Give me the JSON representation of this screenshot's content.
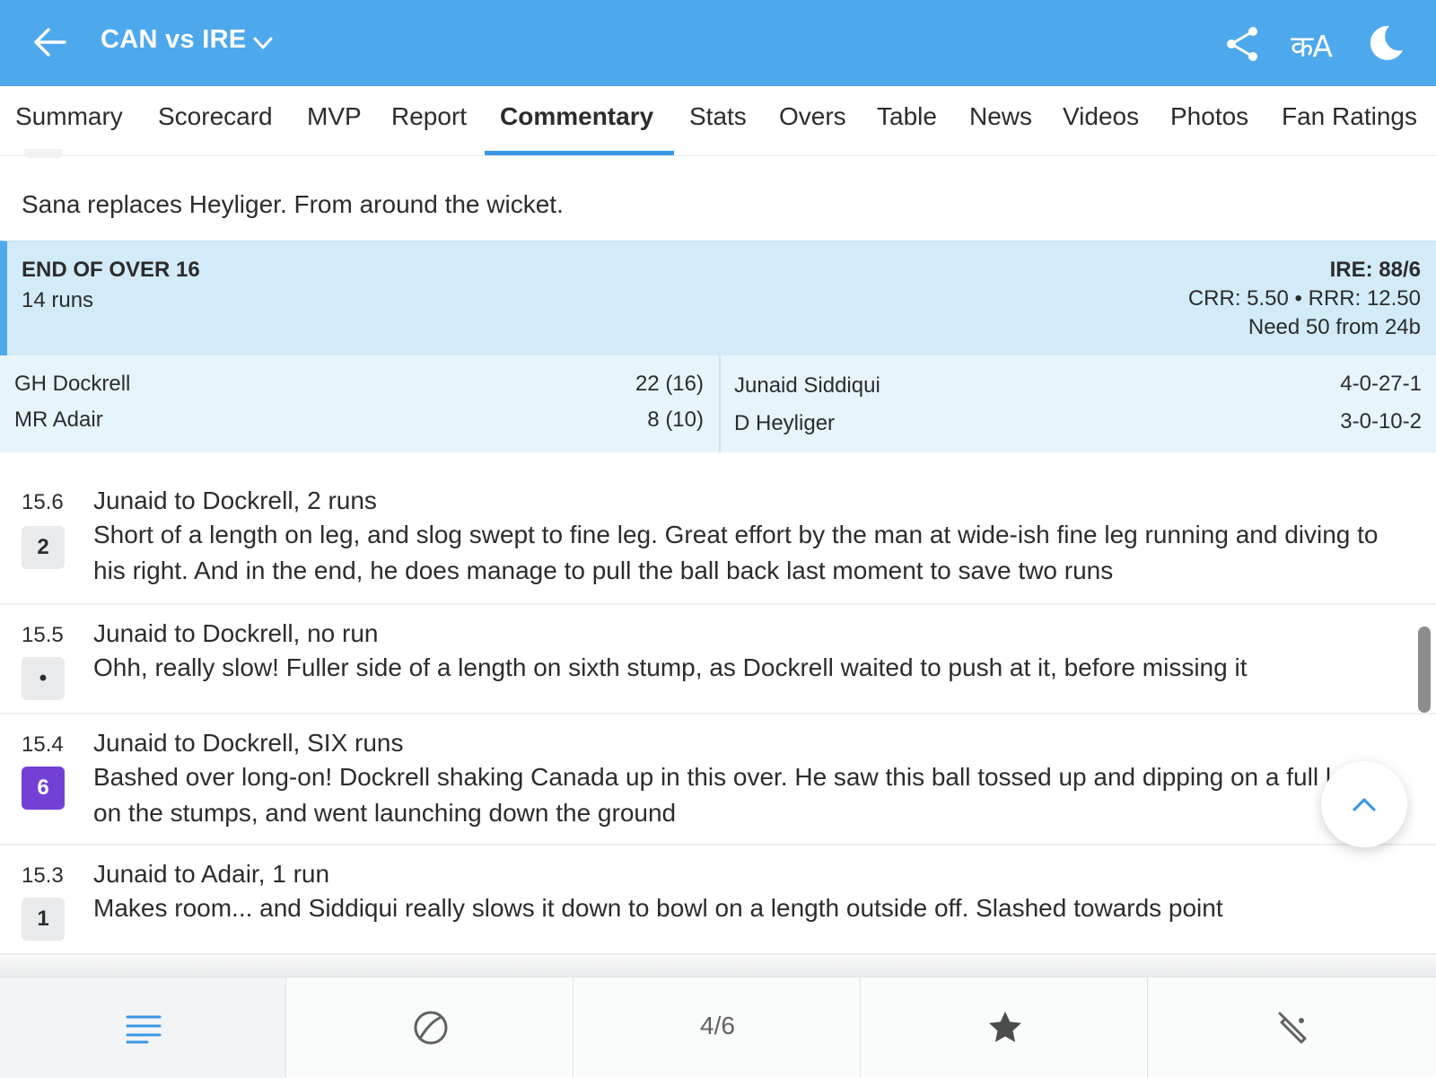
{
  "appbar": {
    "title": "CAN vs IRE",
    "lang_label": "कA",
    "icons": {
      "back": "arrow-left-icon",
      "title_dropdown": "chevron-down-icon",
      "share": "share-icon",
      "theme": "moon-icon"
    },
    "background": "#4ea8ec"
  },
  "tabs": [
    {
      "label": "Summary"
    },
    {
      "label": "Scorecard"
    },
    {
      "label": "MVP"
    },
    {
      "label": "Report"
    },
    {
      "label": "Commentary",
      "active": true
    },
    {
      "label": "Stats"
    },
    {
      "label": "Overs"
    },
    {
      "label": "Table"
    },
    {
      "label": "News"
    },
    {
      "label": "Videos"
    },
    {
      "label": "Photos"
    },
    {
      "label": "Fan Ratings"
    }
  ],
  "commentary": {
    "bowler_change": "Sana replaces Heyliger. From around the wicket.",
    "end_of_over": {
      "title": "END OF OVER 16",
      "runs": "14 runs",
      "score": "IRE: 88/6",
      "rates": "CRR: 5.50 • RRR: 12.50",
      "need": "Need 50 from 24b",
      "batters": [
        {
          "name": "GH Dockrell",
          "figures": "22 (16)"
        },
        {
          "name": "MR Adair",
          "figures": "8 (10)"
        }
      ],
      "bowlers": [
        {
          "name": "Junaid Siddiqui",
          "figures": "4-0-27-1"
        },
        {
          "name": "D Heyliger",
          "figures": "3-0-10-2"
        }
      ]
    },
    "balls": [
      {
        "over": "15.6",
        "badge": "2",
        "title": "Junaid to Dockrell, 2 runs",
        "text": "Short of a length on leg, and slog swept to fine leg. Great effort by the man at wide-ish fine leg running and diving to his right. And in the end, he does manage to pull the ball back last moment to save two runs"
      },
      {
        "over": "15.5",
        "badge": "•",
        "title": "Junaid to Dockrell, no run",
        "text": "Ohh, really slow! Fuller side of a length on sixth stump, as Dockrell waited to push at it, before missing it"
      },
      {
        "over": "15.4",
        "badge": "6",
        "badge_color": "#7340d6",
        "title": "Junaid to Dockrell, SIX runs",
        "text": "Bashed over long-on! Dockrell shaking Canada up in this over. He saw this ball tossed up and dipping on a full length on the stumps, and went launching down the ground"
      },
      {
        "over": "15.3",
        "badge": "1",
        "title": "Junaid to Adair, 1 run",
        "text": "Makes room... and Siddiqui really slows it down to bowl on a length outside off. Slashed towards point"
      }
    ]
  },
  "bottom_nav": {
    "page_indicator": "4/6",
    "icons": [
      "menu-lines-icon",
      "ball-icon",
      "page-indicator",
      "star-icon",
      "bat-icon"
    ],
    "accent": "#3a98e6"
  },
  "scroll_top_icon": "chevron-up-icon"
}
